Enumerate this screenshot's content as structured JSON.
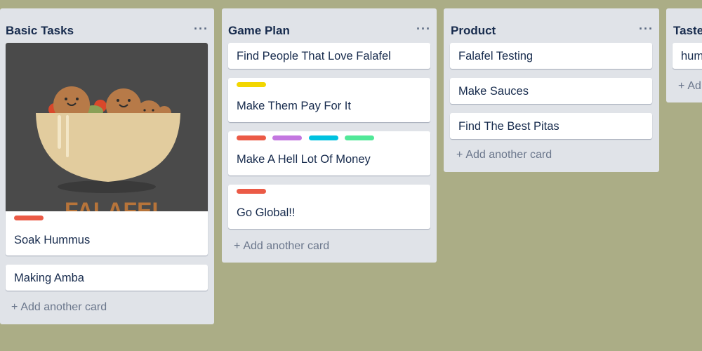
{
  "board": {
    "lists": [
      {
        "title": "Basic Tasks",
        "cards": [
          {
            "title": "Soak Hummus",
            "cover_text": "FALAFEL",
            "labels": [
              "#eb5a46"
            ]
          },
          {
            "title": "Making Amba"
          }
        ],
        "add_label": "Add another card"
      },
      {
        "title": "Game Plan",
        "cards": [
          {
            "title": "Find People That Love Falafel"
          },
          {
            "title": "Make Them Pay For It",
            "labels": [
              "#f2d600"
            ]
          },
          {
            "title": "Make A Hell Lot Of Money",
            "labels": [
              "#eb5a46",
              "#c377e0",
              "#00c2e0",
              "#51e898"
            ]
          },
          {
            "title": "Go Global!!",
            "labels": [
              "#eb5a46"
            ]
          }
        ],
        "add_label": "Add another card"
      },
      {
        "title": "Product",
        "cards": [
          {
            "title": "Falafel Testing"
          },
          {
            "title": "Make Sauces"
          },
          {
            "title": "Find The Best Pitas"
          }
        ],
        "add_label": "Add another card"
      },
      {
        "title": "Taste",
        "cards": [
          {
            "title": "hum"
          }
        ],
        "add_label": "Ad"
      }
    ],
    "menu_glyph": "···",
    "plus_glyph": "+"
  }
}
